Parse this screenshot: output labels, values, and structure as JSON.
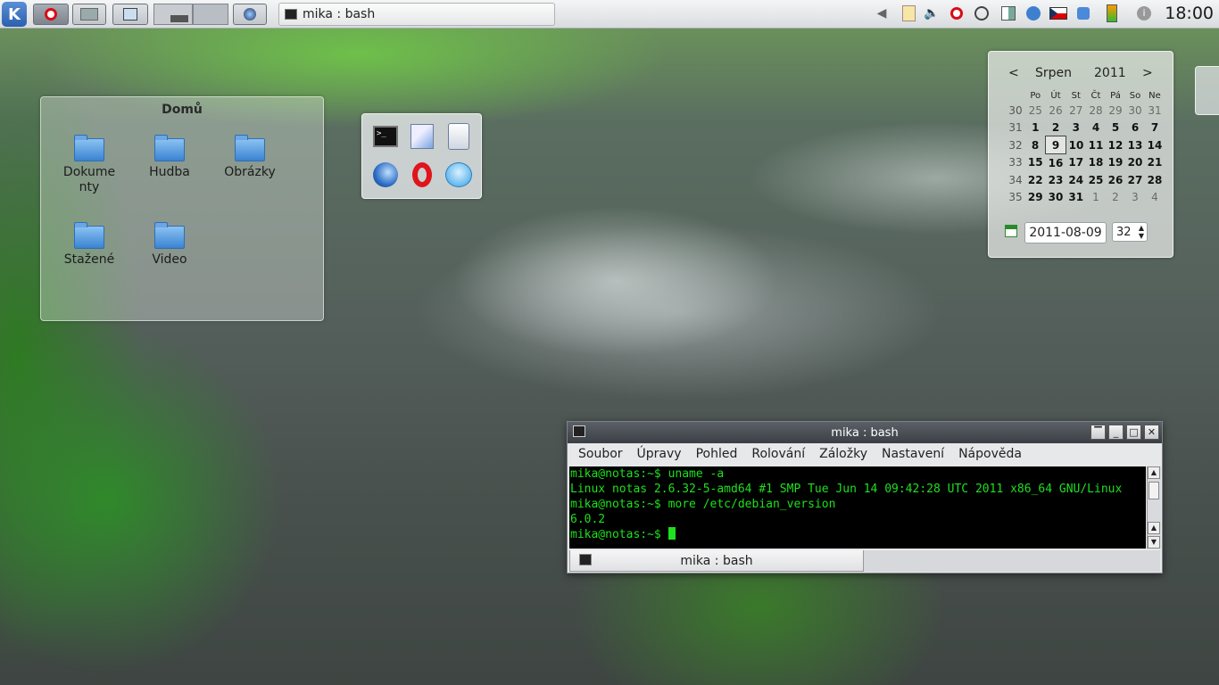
{
  "panel": {
    "task_title": "mika : bash",
    "clock": "18:00",
    "tray_icons": [
      "clipboard-icon",
      "volume-icon",
      "opera-icon",
      "media-icon",
      "network-icon",
      "kde-icon",
      "keyboard-layout-icon",
      "bluetooth-icon",
      "battery-icon",
      "info-icon"
    ]
  },
  "folderview": {
    "title": "Domů",
    "items": [
      {
        "label": "Dokume\nnty"
      },
      {
        "label": "Hudba"
      },
      {
        "label": "Obrázky"
      },
      {
        "label": "Stažené"
      },
      {
        "label": "Video"
      }
    ]
  },
  "calendar": {
    "prev": "<",
    "next": ">",
    "month": "Srpen",
    "year": "2011",
    "weekdays": [
      "Po",
      "Út",
      "St",
      "Čt",
      "Pá",
      "So",
      "Ne"
    ],
    "weeks": [
      {
        "week": "30",
        "days": [
          "25",
          "26",
          "27",
          "28",
          "29",
          "30",
          "31"
        ]
      },
      {
        "week": "31",
        "days": [
          "1",
          "2",
          "3",
          "4",
          "5",
          "6",
          "7"
        ]
      },
      {
        "week": "32",
        "days": [
          "8",
          "9",
          "10",
          "11",
          "12",
          "13",
          "14"
        ]
      },
      {
        "week": "33",
        "days": [
          "15",
          "16",
          "17",
          "18",
          "19",
          "20",
          "21"
        ]
      },
      {
        "week": "34",
        "days": [
          "22",
          "23",
          "24",
          "25",
          "26",
          "27",
          "28"
        ]
      },
      {
        "week": "35",
        "days": [
          "29",
          "30",
          "31",
          "1",
          "2",
          "3",
          "4"
        ]
      }
    ],
    "date_value": "2011-08-09",
    "week_value": "32",
    "today": "9"
  },
  "konsole": {
    "title": "mika : bash",
    "menu": [
      "Soubor",
      "Úpravy",
      "Pohled",
      "Rolování",
      "Záložky",
      "Nastavení",
      "Nápověda"
    ],
    "lines": [
      "mika@notas:~$ uname -a",
      "Linux notas 2.6.32-5-amd64 #1 SMP Tue Jun 14 09:42:28 UTC 2011 x86_64 GNU/Linux",
      "mika@notas:~$ more /etc/debian_version",
      "6.0.2",
      "mika@notas:~$ "
    ],
    "tab_label": "mika : bash"
  },
  "colors": {
    "terminal_fg": "#1ee01e",
    "terminal_bg": "#000000",
    "kde_blue": "#2c5fae",
    "opera_red": "#d80d17"
  }
}
